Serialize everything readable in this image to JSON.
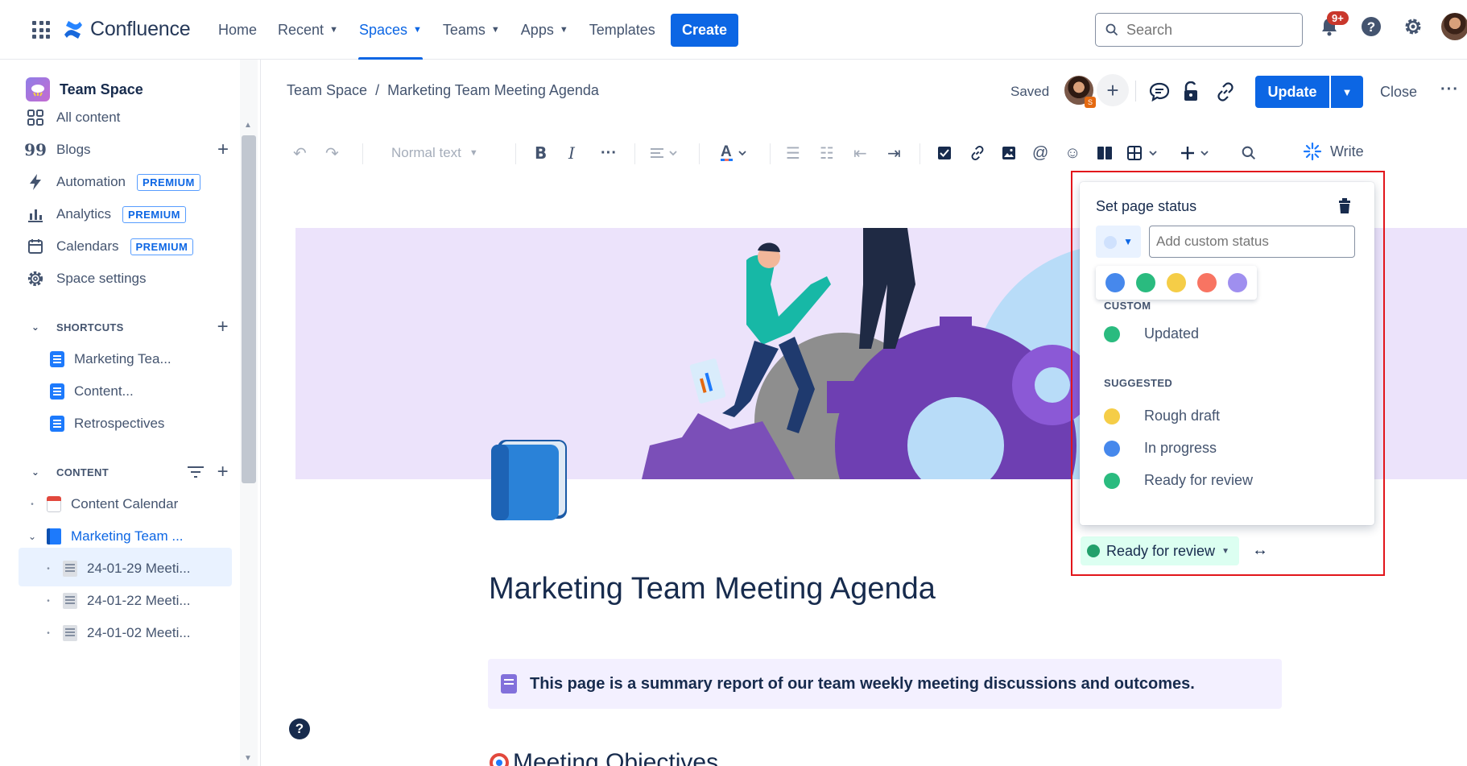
{
  "topnav": {
    "brand": "Confluence",
    "items": [
      {
        "label": "Home",
        "has_menu": false
      },
      {
        "label": "Recent",
        "has_menu": true
      },
      {
        "label": "Spaces",
        "has_menu": true
      },
      {
        "label": "Teams",
        "has_menu": true
      },
      {
        "label": "Apps",
        "has_menu": true
      },
      {
        "label": "Templates",
        "has_menu": false
      }
    ],
    "active_item": "Spaces",
    "create_label": "Create",
    "search_placeholder": "Search",
    "notification_count": "9+",
    "icons": [
      "app-switcher-icon",
      "search-icon",
      "bell-icon",
      "help-icon",
      "gear-icon",
      "avatar"
    ]
  },
  "sidebar": {
    "space_name": "Team Space",
    "items": [
      {
        "label": "All content",
        "icon": "grid-icon"
      },
      {
        "label": "Blogs",
        "icon": "quote-icon"
      },
      {
        "label": "Automation",
        "icon": "bolt-icon",
        "badge": "PREMIUM"
      },
      {
        "label": "Analytics",
        "icon": "bar-chart-icon",
        "badge": "PREMIUM"
      },
      {
        "label": "Calendars",
        "icon": "calendar-icon",
        "badge": "PREMIUM"
      },
      {
        "label": "Space settings",
        "icon": "gear-icon"
      }
    ],
    "shortcuts_label": "SHORTCUTS",
    "shortcuts": [
      "Marketing Tea...",
      "Content...",
      "Retrospectives"
    ],
    "content_label": "CONTENT",
    "content_tree": [
      {
        "label": "Content Calendar",
        "icon": "calendar-page-icon",
        "level": 0
      },
      {
        "label": "Marketing Team ...",
        "icon": "book-icon",
        "level": 0,
        "selected": true
      },
      {
        "label": "24-01-29 Meeti...",
        "icon": "page-icon",
        "level": 1
      },
      {
        "label": "24-01-22 Meeti...",
        "icon": "page-icon",
        "level": 1
      },
      {
        "label": "24-01-02 Meeti...",
        "icon": "page-icon",
        "level": 1
      }
    ]
  },
  "page_header": {
    "breadcrumb": [
      "Team Space",
      "Marketing Team Meeting Agenda"
    ],
    "breadcrumb_separator": "/",
    "saved_label": "Saved",
    "update_label": "Update",
    "close_label": "Close"
  },
  "toolbar": {
    "text_style": "Normal text",
    "write_label": "Write"
  },
  "page": {
    "title": "Marketing Team Meeting Agenda",
    "panel_text": "This page is a summary report of our team weekly meeting discussions and outcomes.",
    "next_heading": "Meeting Objectives",
    "status": "Ready for review",
    "status_color": "#22a06b"
  },
  "status_popup": {
    "title": "Set page status",
    "input_placeholder": "Add custom status",
    "colors": [
      "#4688ec",
      "#2abb7f",
      "#f5cd47",
      "#f87462",
      "#9f8fef"
    ],
    "custom_label": "CUSTOM",
    "custom_items": [
      {
        "label": "Updated",
        "color": "#2abb7f"
      }
    ],
    "suggested_label": "SUGGESTED",
    "suggested_items": [
      {
        "label": "Rough draft",
        "color": "#f5cd47"
      },
      {
        "label": "In progress",
        "color": "#4688ec"
      },
      {
        "label": "Ready for review",
        "color": "#2abb7f"
      }
    ]
  }
}
